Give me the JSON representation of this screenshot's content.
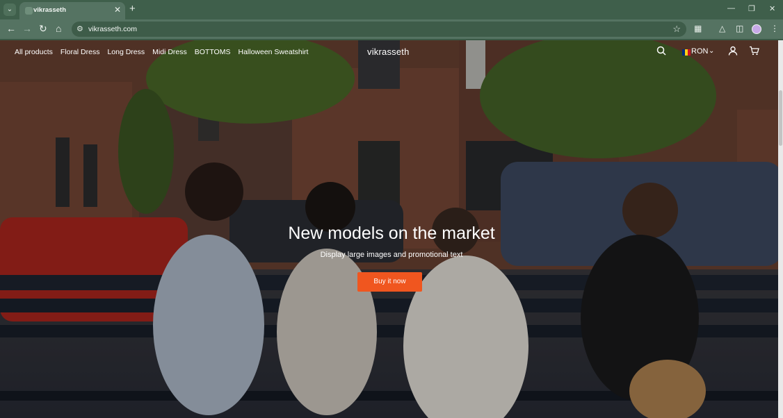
{
  "browser": {
    "tab_title": "vikrasseth",
    "url": "vikrasseth.com",
    "icons": {
      "tab_menu": "chevron-down-icon",
      "close_tab": "close-icon",
      "new_tab": "plus-icon",
      "back": "arrow-left-icon",
      "forward": "arrow-right-icon",
      "reload": "reload-icon",
      "home": "home-icon",
      "site_info": "tune-icon",
      "bookmark": "star-icon",
      "extensions": "puzzle-icon",
      "labs": "flask-icon",
      "side_panel": "side-panel-icon",
      "profile": "profile-avatar",
      "menu": "kebab-menu-icon",
      "minimize": "minimize-icon",
      "maximize": "maximize-icon",
      "close_window": "close-icon"
    },
    "colors": {
      "frame": "#3f5f4b",
      "toolbar": "#557362",
      "omnibox": "#3e5c49"
    }
  },
  "site": {
    "logo": "vikrasseth",
    "nav": [
      "All products",
      "Floral Dress",
      "Long Dress",
      "Midi Dress",
      "BOTTOMS",
      "Halloween Sweatshirt"
    ],
    "currency": "RON",
    "header_icons": [
      "search-icon",
      "user-icon",
      "cart-icon"
    ],
    "hero": {
      "title": "New models on the market",
      "subtitle": "Display large images and promotional text",
      "cta_label": "Buy it now"
    },
    "colors": {
      "cta": "#f0561f",
      "text": "#ffffff"
    }
  }
}
